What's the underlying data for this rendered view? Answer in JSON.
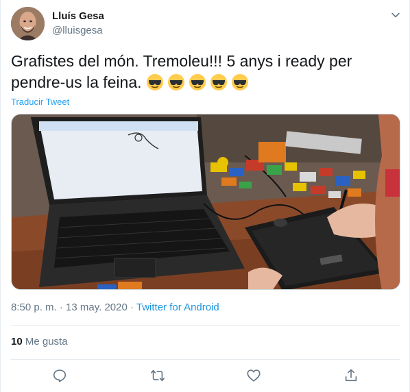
{
  "author": {
    "name": "Lluís Gesa",
    "handle": "@lluisgesa"
  },
  "tweet": {
    "text": "Grafistes del món. Tremoleu!!!  5 anys i ready per pendre-us la feina.",
    "emojis": [
      "sunglasses-emoji",
      "sunglasses-emoji",
      "sunglasses-emoji",
      "sunglasses-emoji",
      "sunglasses-emoji"
    ],
    "translate_label": "Traducir Tweet"
  },
  "meta": {
    "time": "8:50 p. m.",
    "separator1": " · ",
    "date": "13 may. 2020",
    "separator2": " · ",
    "source": "Twitter for Android"
  },
  "stats": {
    "likes_count": "10",
    "likes_label": "Me gusta"
  },
  "actions": {
    "reply_icon": "reply-icon",
    "retweet_icon": "retweet-icon",
    "like_icon": "heart-icon",
    "share_icon": "share-icon"
  },
  "colors": {
    "link": "#1da1f2",
    "secondary_text": "#657786",
    "divider": "#e6ecf0"
  }
}
